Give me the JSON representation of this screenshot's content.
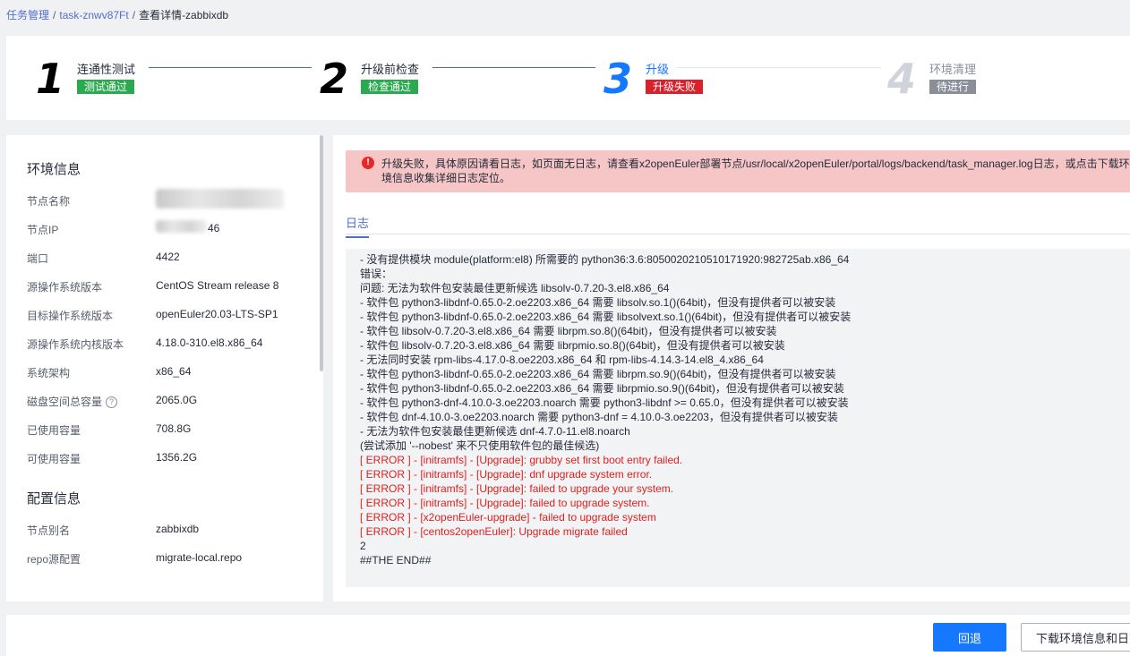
{
  "breadcrumb": {
    "item1": "任务管理",
    "item2": "task-znwv87Ft",
    "item3": "查看详情-zabbixdb",
    "separator": "/"
  },
  "steps": [
    {
      "num": "1",
      "title": "连通性测试",
      "status": "测试通过",
      "status_color": "#2aaa4f",
      "num_color": "#000000",
      "title_color": "#252b3a"
    },
    {
      "num": "2",
      "title": "升级前检查",
      "status": "检查通过",
      "status_color": "#2aaa4f",
      "num_color": "#000000",
      "title_color": "#252b3a"
    },
    {
      "num": "3",
      "title": "升级",
      "status": "升级失败",
      "status_color": "#d9202b",
      "num_color": "#1677ff",
      "title_color": "#1677ff"
    },
    {
      "num": "4",
      "title": "环境清理",
      "status": "待进行",
      "status_color": "#8a8e99",
      "num_color": "#d0d3d9",
      "title_color": "#8a8e99"
    }
  ],
  "env": {
    "title": "环境信息",
    "items": [
      {
        "label": "节点名称",
        "value": ""
      },
      {
        "label": "节点IP",
        "value": "46"
      },
      {
        "label": "端口",
        "value": "4422"
      },
      {
        "label": "源操作系统版本",
        "value": "CentOS Stream release 8"
      },
      {
        "label": "目标操作系统版本",
        "value": "openEuler20.03-LTS-SP1"
      },
      {
        "label": "源操作系统内核版本",
        "value": "4.18.0-310.el8.x86_64"
      },
      {
        "label": "系统架构",
        "value": "x86_64"
      },
      {
        "label": "磁盘空间总容量",
        "value": "2065.0G"
      },
      {
        "label": "已使用容量",
        "value": "708.8G"
      },
      {
        "label": "可使用容量",
        "value": "1356.2G"
      }
    ],
    "help_glyph": "?"
  },
  "config": {
    "title": "配置信息",
    "items": [
      {
        "label": "节点别名",
        "value": "zabbixdb"
      },
      {
        "label": "repo源配置",
        "value": "migrate-local.repo"
      }
    ]
  },
  "alert": {
    "icon": "!",
    "text": "升级失败，具体原因请看日志，如页面无日志，请查看x2openEuler部署节点/usr/local/x2openEuler/portal/logs/backend/task_manager.log日志，或点击下载环境信息收集详细日志定位。"
  },
  "tab": {
    "label": "日志"
  },
  "log": [
    {
      "text": "- 没有提供模块 module(platform:el8) 所需要的 python36:3.6:8050020210510171920:982725ab.x86_64",
      "error": false
    },
    {
      "text": "错误：",
      "error": false
    },
    {
      "text": "问题: 无法为软件包安装最佳更新候选 libsolv-0.7.20-3.el8.x86_64",
      "error": false
    },
    {
      "text": "- 软件包 python3-libdnf-0.65.0-2.oe2203.x86_64 需要 libsolv.so.1()(64bit)，但没有提供者可以被安装",
      "error": false
    },
    {
      "text": "- 软件包 python3-libdnf-0.65.0-2.oe2203.x86_64 需要 libsolvext.so.1()(64bit)，但没有提供者可以被安装",
      "error": false
    },
    {
      "text": "- 软件包 libsolv-0.7.20-3.el8.x86_64 需要 librpm.so.8()(64bit)，但没有提供者可以被安装",
      "error": false
    },
    {
      "text": "- 软件包 libsolv-0.7.20-3.el8.x86_64 需要 librpmio.so.8()(64bit)，但没有提供者可以被安装",
      "error": false
    },
    {
      "text": "- 无法同时安装 rpm-libs-4.17.0-8.oe2203.x86_64 和 rpm-libs-4.14.3-14.el8_4.x86_64",
      "error": false
    },
    {
      "text": "- 软件包 python3-libdnf-0.65.0-2.oe2203.x86_64 需要 librpm.so.9()(64bit)，但没有提供者可以被安装",
      "error": false
    },
    {
      "text": "- 软件包 python3-libdnf-0.65.0-2.oe2203.x86_64 需要 librpmio.so.9()(64bit)，但没有提供者可以被安装",
      "error": false
    },
    {
      "text": "- 软件包 python3-dnf-4.10.0-3.oe2203.noarch 需要 python3-libdnf >= 0.65.0，但没有提供者可以被安装",
      "error": false
    },
    {
      "text": "- 软件包 dnf-4.10.0-3.oe2203.noarch 需要 python3-dnf = 4.10.0-3.oe2203，但没有提供者可以被安装",
      "error": false
    },
    {
      "text": "- 无法为软件包安装最佳更新候选 dnf-4.7.0-11.el8.noarch",
      "error": false
    },
    {
      "text": "(尝试添加 '--nobest' 来不只使用软件包的最佳候选)",
      "error": false
    },
    {
      "text": "[ ERROR ] - [initramfs] - [Upgrade]: grubby set first boot entry failed.",
      "error": true
    },
    {
      "text": "[ ERROR ] - [initramfs] - [Upgrade]: dnf upgrade system error.",
      "error": true
    },
    {
      "text": "[ ERROR ] - [initramfs] - [Upgrade]: failed to upgrade your system.",
      "error": true
    },
    {
      "text": "[ ERROR ] - [initramfs] - [Upgrade]: failed to upgrade system.",
      "error": true
    },
    {
      "text": "[ ERROR ] - [x2openEuler-upgrade] - failed to upgrade system",
      "error": true
    },
    {
      "text": "[ ERROR ] - [centos2openEuler]: Upgrade migrate failed",
      "error": true
    },
    {
      "text": "2",
      "error": false
    },
    {
      "text": "##THE END##",
      "error": false
    }
  ],
  "footer": {
    "rollback_label": "回退",
    "download_label": "下载环境信息和日志"
  }
}
